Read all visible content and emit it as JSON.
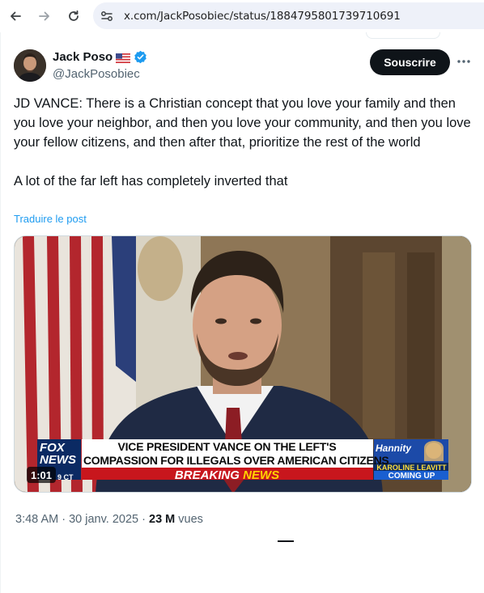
{
  "browser": {
    "url": "x.com/JackPosobiec/status/1884795801739710691",
    "icons": [
      "back-arrow-icon",
      "forward-arrow-icon",
      "reload-icon",
      "site-settings-icon"
    ]
  },
  "tweet": {
    "author": {
      "display_name": "Jack Poso",
      "flag": "🇺🇸",
      "handle": "@JackPosobiec",
      "verified": true,
      "verified_color": "#1d9bf0"
    },
    "subscribe_label": "Souscrire",
    "more_icon": "more-horizontal-icon",
    "text_p1": "JD VANCE: There is a Christian concept that you love your family and then you love your neighbor, and then you love your community, and then you love your fellow citizens, and then after that, prioritize the rest of the world",
    "text_p2": "A lot of the far left has completely inverted that",
    "translate_label": "Traduire le post",
    "media": {
      "duration": "1:01",
      "network_logo": "FOX NEWS",
      "timezone": "9 CT",
      "chyron_line1": "VICE PRESIDENT VANCE ON THE LEFT'S",
      "chyron_line2": "COMPASSION FOR ILLEGALS OVER AMERICAN CITIZENS",
      "breaking_word1": "BREAKING",
      "breaking_word2": "NEWS",
      "show_name": "Hannity",
      "upnext_name": "KAROLINE LEAVITT",
      "upnext_label": "COMING UP"
    },
    "time": "3:48 AM",
    "separator": "·",
    "date": "30 janv. 2025",
    "views_count": "23 M",
    "views_label": "vues"
  },
  "colors": {
    "accent": "#1d9bf0",
    "text_primary": "#0f1419",
    "text_secondary": "#536471",
    "button_bg": "#0f1419"
  }
}
